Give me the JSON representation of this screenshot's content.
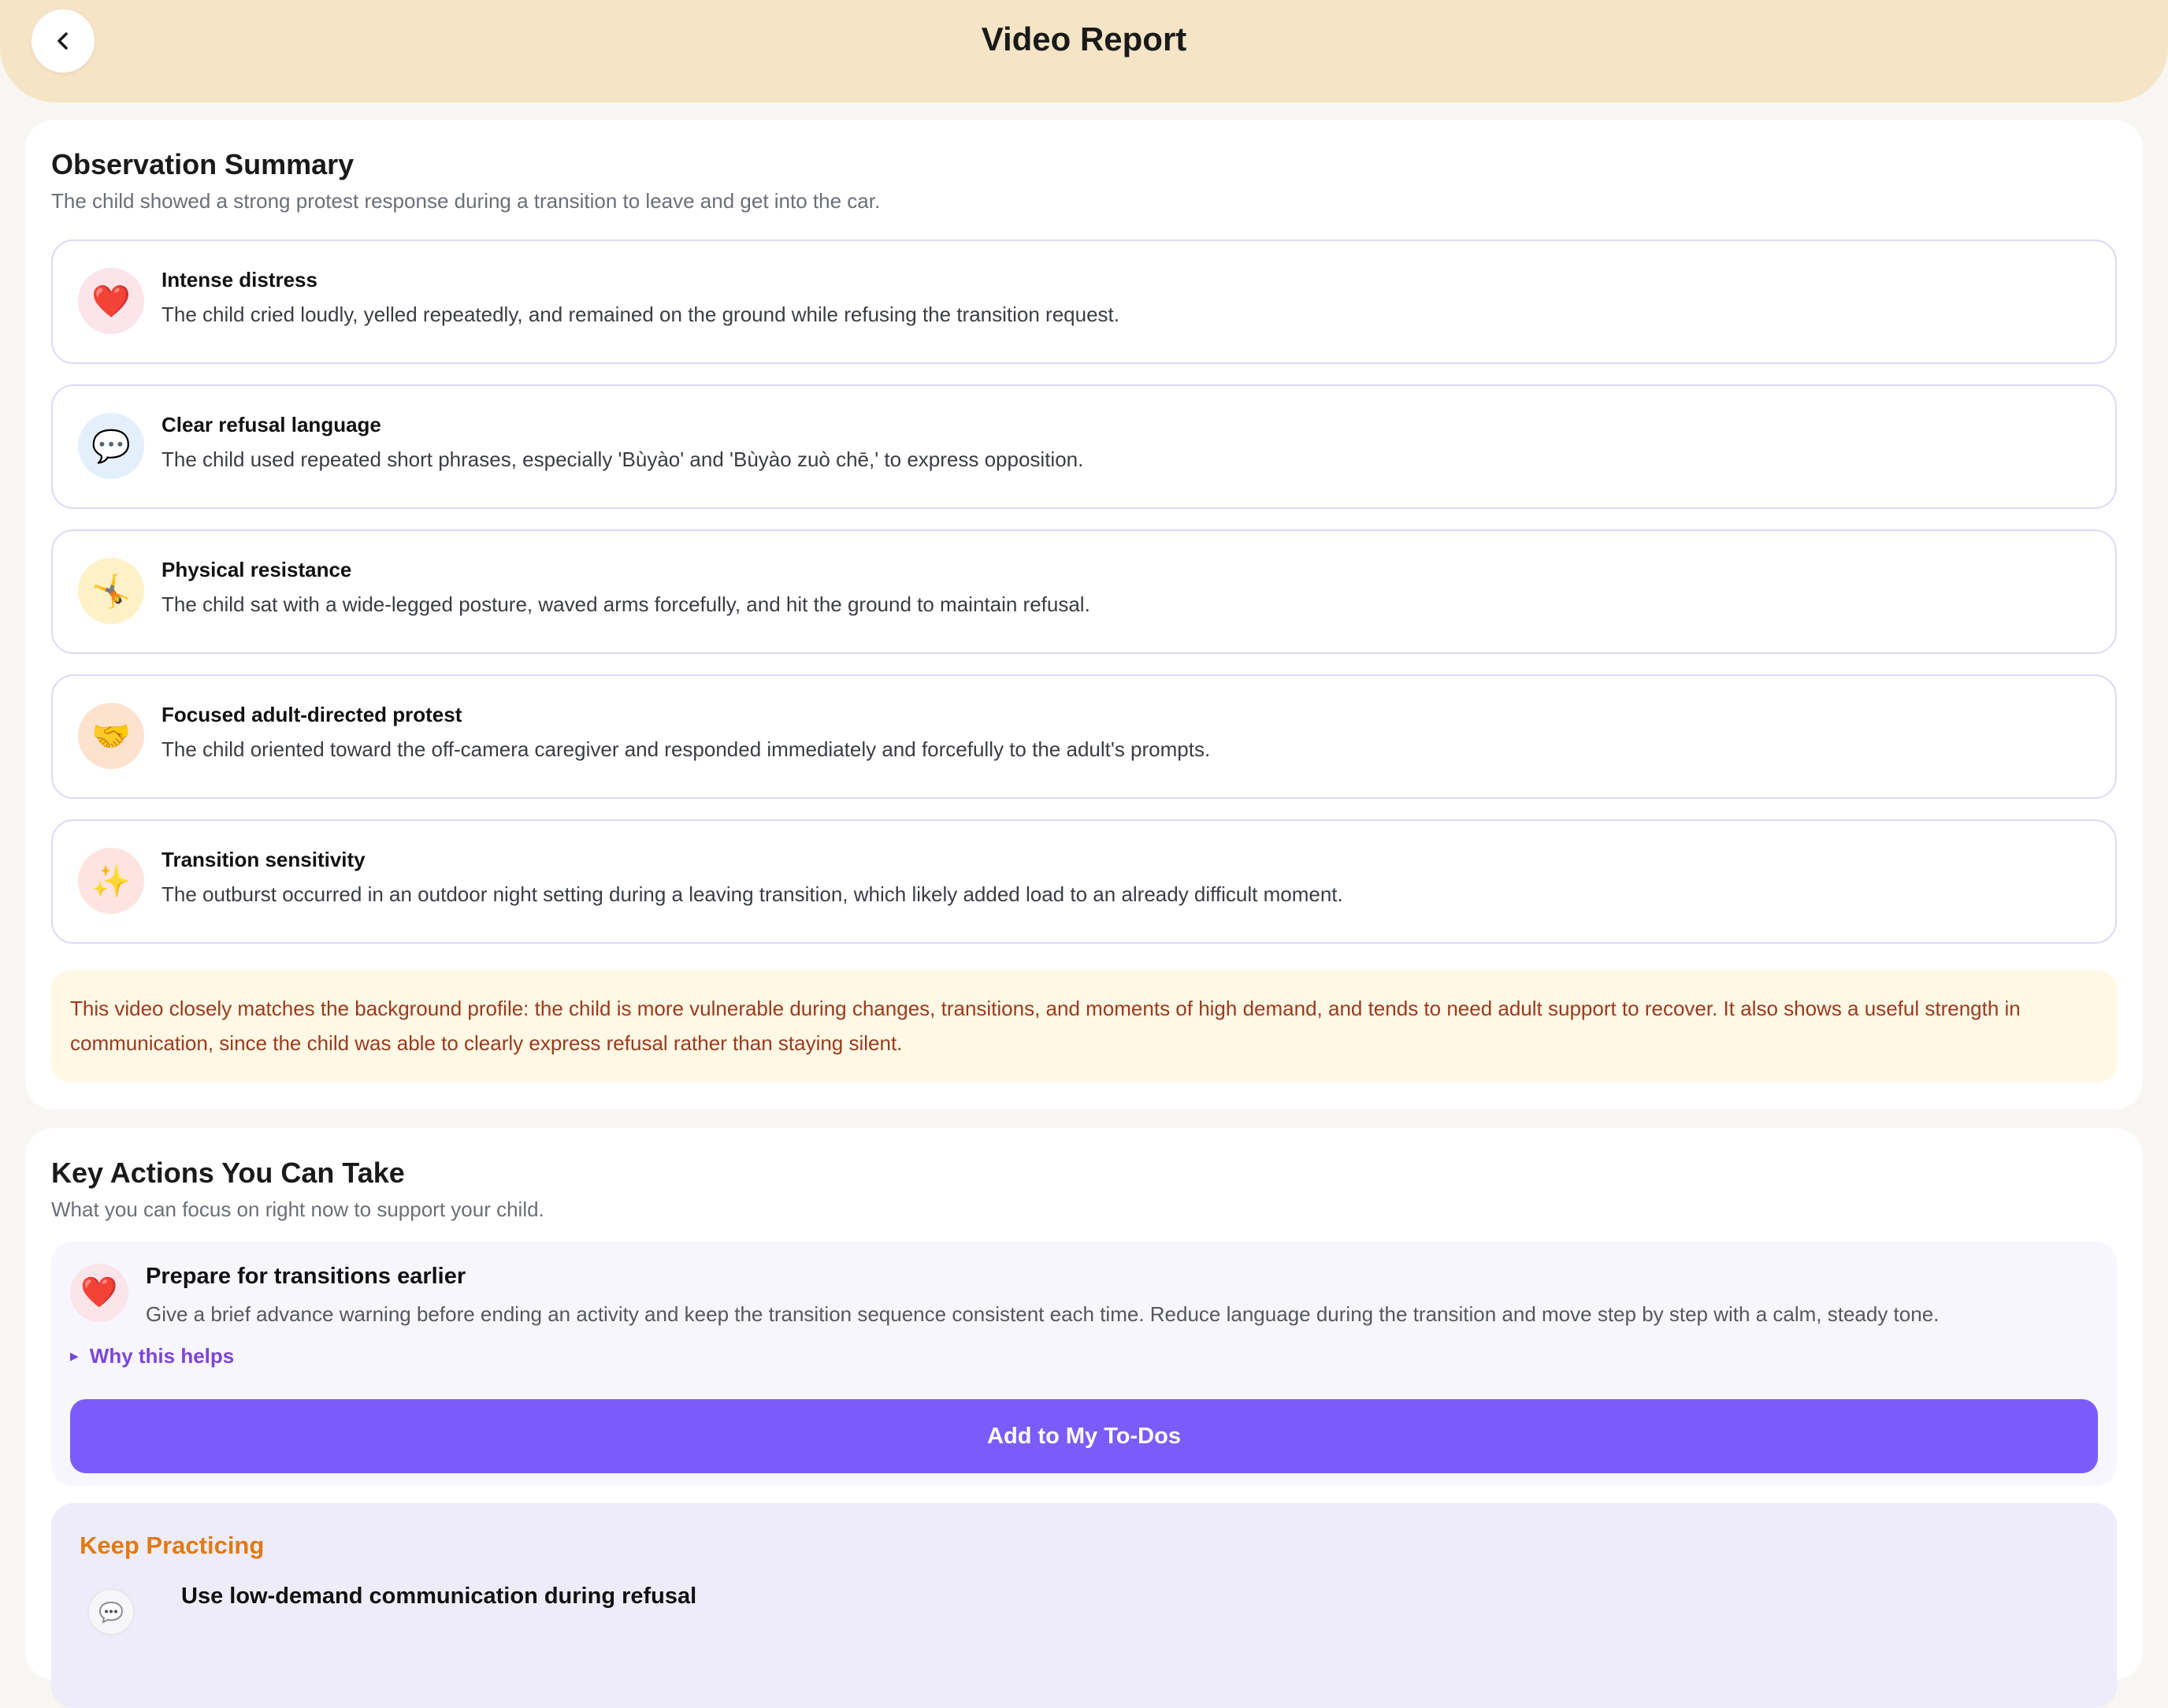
{
  "header": {
    "title": "Video Report",
    "back_icon": "chevron-left-icon"
  },
  "observation": {
    "title": "Observation Summary",
    "subtitle": "The child showed a strong protest response during a transition to leave and get into the car.",
    "items": [
      {
        "icon": "❤️",
        "icon_name": "heart-icon",
        "icon_bg": "#fbe4ea",
        "title": "Intense distress",
        "text": "The child cried loudly, yelled repeatedly, and remained on the ground while refusing the transition request."
      },
      {
        "icon": "💬",
        "icon_name": "speech-bubble-icon",
        "icon_bg": "#e3f0fc",
        "title": "Clear refusal language",
        "text": "The child used repeated short phrases, especially 'Bùyào' and 'Bùyào zuò chē,' to express opposition."
      },
      {
        "icon": "🤸",
        "icon_name": "cartwheel-icon",
        "icon_bg": "#fdf1c8",
        "title": "Physical resistance",
        "text": "The child sat with a wide-legged posture, waved arms forcefully, and hit the ground to maintain refusal."
      },
      {
        "icon": "🤝",
        "icon_name": "handshake-icon",
        "icon_bg": "#fde3cf",
        "title": "Focused adult-directed protest",
        "text": "The child oriented toward the off-camera caregiver and responded immediately and forcefully to the adult's prompts."
      },
      {
        "icon": "✨",
        "icon_name": "sparkles-icon",
        "icon_bg": "#fde4e0",
        "title": "Transition sensitivity",
        "text": "The outburst occurred in an outdoor night setting during a leaving transition, which likely added load to an already difficult moment."
      }
    ],
    "note": "This video closely matches the background profile: the child is more vulnerable during changes, transitions, and moments of high demand, and tends to need adult support to recover. It also shows a useful strength in communication, since the child was able to clearly express refusal rather than staying silent."
  },
  "key_actions": {
    "title": "Key Actions You Can Take",
    "subtitle": "What you can focus on right now to support your child.",
    "action": {
      "icon": "❤️",
      "icon_name": "heart-icon",
      "title": "Prepare for transitions earlier",
      "text": "Give a brief advance warning before ending an activity and keep the transition sequence consistent each time. Reduce language during the transition and move step by step with a calm, steady tone.",
      "why_label": "Why this helps",
      "button_label": "Add to My To-Dos"
    },
    "practice": {
      "label": "Keep Practicing",
      "icon_name": "speech-bubble-icon",
      "title": "Use low-demand communication during refusal"
    }
  },
  "colors": {
    "header_bg": "#f5e5c6",
    "accent": "#7b5cfa",
    "note_text": "#9a3a1f",
    "practice_label": "#e07a12"
  }
}
